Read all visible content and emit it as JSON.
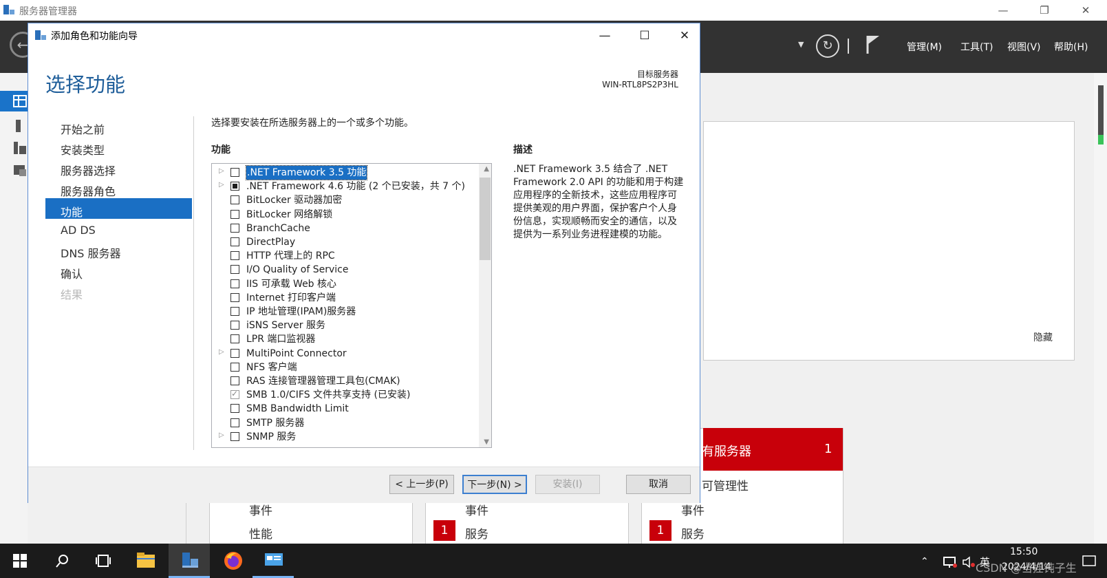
{
  "server_manager": {
    "title": "服务器管理器",
    "menu": {
      "manage": "管理(M)",
      "tools": "工具(T)",
      "view": "视图(V)",
      "help": "帮助(H)"
    },
    "window_controls": {
      "minimize": "—",
      "restore": "❐",
      "close": "✕"
    },
    "background": {
      "hide_label": "隐藏",
      "tile_header_text": "有服务器",
      "tile_header_count": "1",
      "tile_manageability": "可管理性",
      "events": "事件",
      "performance": "性能",
      "services": "服务",
      "badge_count": "1"
    }
  },
  "dialog": {
    "title": "添加角色和功能向导",
    "controls": {
      "minimize": "—",
      "maximize": "☐",
      "close": "✕"
    },
    "page_title": "选择功能",
    "target_server_label": "目标服务器",
    "target_server_name": "WIN-RTL8PS2P3HL",
    "steps": [
      {
        "label": "开始之前",
        "state": "normal"
      },
      {
        "label": "安装类型",
        "state": "normal"
      },
      {
        "label": "服务器选择",
        "state": "normal"
      },
      {
        "label": "服务器角色",
        "state": "normal"
      },
      {
        "label": "功能",
        "state": "active"
      },
      {
        "label": "AD DS",
        "state": "normal"
      },
      {
        "label": "DNS 服务器",
        "state": "normal"
      },
      {
        "label": "确认",
        "state": "normal"
      },
      {
        "label": "结果",
        "state": "disabled"
      }
    ],
    "instruction": "选择要安装在所选服务器上的一个或多个功能。",
    "features_heading": "功能",
    "features": [
      {
        "label": ".NET Framework 3.5 功能",
        "expandable": true,
        "state": "unchecked",
        "selected": true
      },
      {
        "label": ".NET Framework 4.6 功能 (2 个已安装，共 7 个)",
        "expandable": true,
        "state": "partial",
        "selected": false
      },
      {
        "label": "BitLocker 驱动器加密",
        "expandable": false,
        "state": "unchecked",
        "selected": false
      },
      {
        "label": "BitLocker 网络解锁",
        "expandable": false,
        "state": "unchecked",
        "selected": false
      },
      {
        "label": "BranchCache",
        "expandable": false,
        "state": "unchecked",
        "selected": false
      },
      {
        "label": "DirectPlay",
        "expandable": false,
        "state": "unchecked",
        "selected": false
      },
      {
        "label": "HTTP 代理上的 RPC",
        "expandable": false,
        "state": "unchecked",
        "selected": false
      },
      {
        "label": "I/O Quality of Service",
        "expandable": false,
        "state": "unchecked",
        "selected": false
      },
      {
        "label": "IIS 可承载 Web 核心",
        "expandable": false,
        "state": "unchecked",
        "selected": false
      },
      {
        "label": "Internet 打印客户端",
        "expandable": false,
        "state": "unchecked",
        "selected": false
      },
      {
        "label": "IP 地址管理(IPAM)服务器",
        "expandable": false,
        "state": "unchecked",
        "selected": false
      },
      {
        "label": "iSNS Server 服务",
        "expandable": false,
        "state": "unchecked",
        "selected": false
      },
      {
        "label": "LPR 端口监视器",
        "expandable": false,
        "state": "unchecked",
        "selected": false
      },
      {
        "label": "MultiPoint Connector",
        "expandable": true,
        "state": "unchecked",
        "selected": false
      },
      {
        "label": "NFS 客户端",
        "expandable": false,
        "state": "unchecked",
        "selected": false
      },
      {
        "label": "RAS 连接管理器管理工具包(CMAK)",
        "expandable": false,
        "state": "unchecked",
        "selected": false
      },
      {
        "label": "SMB 1.0/CIFS 文件共享支持 (已安装)",
        "expandable": false,
        "state": "checked",
        "selected": false
      },
      {
        "label": "SMB Bandwidth Limit",
        "expandable": false,
        "state": "unchecked",
        "selected": false
      },
      {
        "label": "SMTP 服务器",
        "expandable": false,
        "state": "unchecked",
        "selected": false
      },
      {
        "label": "SNMP 服务",
        "expandable": true,
        "state": "unchecked",
        "selected": false
      }
    ],
    "description_heading": "描述",
    "description": ".NET Framework 3.5 结合了 .NET Framework 2.0 API 的功能和用于构建应用程序的全新技术，这些应用程序可提供美观的用户界面，保护客户个人身份信息，实现顺畅而安全的通信，以及提供为一系列业务进程建模的功能。",
    "buttons": {
      "previous": "< 上一步(P)",
      "next": "下一步(N) >",
      "install": "安装(I)",
      "cancel": "取消"
    }
  },
  "taskbar": {
    "time": "15:50",
    "date": "2024/4/14",
    "ime": "英",
    "watermark": "CSDN @当挂钝子生"
  }
}
